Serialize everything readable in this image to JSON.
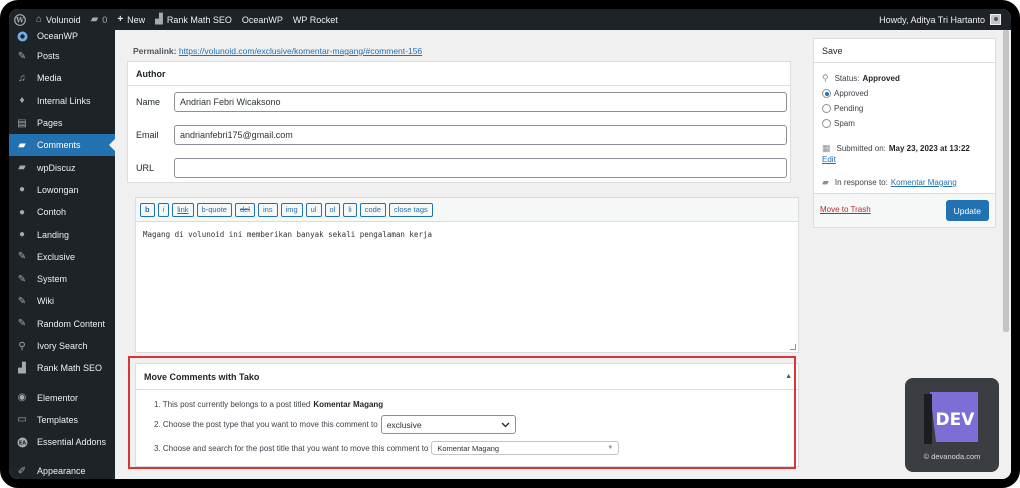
{
  "adminbar": {
    "site_name": "Volunoid",
    "comments_count": "0",
    "new_label": "New",
    "rank_math": "Rank Math SEO",
    "oceanwp": "OceanWP",
    "wp_rocket": "WP Rocket",
    "howdy": "Howdy, Aditya Tri Hartanto"
  },
  "sidebar": {
    "items": [
      {
        "label": "OceanWP",
        "icon": "oceanwp-icon"
      },
      {
        "label": "Posts",
        "icon": "pin-icon"
      },
      {
        "label": "Media",
        "icon": "media-icon"
      },
      {
        "label": "Internal Links",
        "icon": "drop-icon"
      },
      {
        "label": "Pages",
        "icon": "pages-icon"
      },
      {
        "label": "Comments",
        "icon": "comment-icon"
      },
      {
        "label": "wpDiscuz",
        "icon": "comment-icon"
      },
      {
        "label": "Lowongan",
        "icon": "globe-icon"
      },
      {
        "label": "Contoh",
        "icon": "globe-icon"
      },
      {
        "label": "Landing",
        "icon": "globe-icon"
      },
      {
        "label": "Exclusive",
        "icon": "pin-icon"
      },
      {
        "label": "System",
        "icon": "pin-icon"
      },
      {
        "label": "Wiki",
        "icon": "pin-icon"
      },
      {
        "label": "Random Content",
        "icon": "pin-icon"
      },
      {
        "label": "Ivory Search",
        "icon": "search-icon"
      },
      {
        "label": "Rank Math SEO",
        "icon": "rank-math-icon"
      },
      {
        "label": "Elementor",
        "icon": "elementor-icon"
      },
      {
        "label": "Templates",
        "icon": "folder-icon"
      },
      {
        "label": "Essential Addons",
        "icon": "ea-icon"
      },
      {
        "label": "Appearance",
        "icon": "brush-icon"
      }
    ],
    "active": "Comments"
  },
  "permalink": {
    "label": "Permalink:",
    "url": "https://volunoid.com/exclusive/komentar-magang/#comment-156"
  },
  "author": {
    "title": "Author",
    "name_label": "Name",
    "name_value": "Andrian Febri Wicaksono",
    "email_label": "Email",
    "email_value": "andrianfebri175@gmail.com",
    "url_label": "URL",
    "url_value": ""
  },
  "editor": {
    "buttons": [
      "b",
      "i",
      "link",
      "b-quote",
      "del",
      "ins",
      "img",
      "ul",
      "ol",
      "li",
      "code",
      "close tags"
    ],
    "content": "Magang di volunoid ini memberikan banyak sekali pengalaman kerja"
  },
  "tako": {
    "title": "Move Comments with Tako",
    "line1_prefix": "1. This post currently belongs to a post titled",
    "line1_post": "Komentar Magang",
    "line2": "2. Choose the post type that you want to move this comment to",
    "post_type": "exclusive",
    "line3": "3. Choose and search for the post title that you want to move this comment to",
    "post_title": "Komentar Magang"
  },
  "save": {
    "title": "Save",
    "status_label": "Status:",
    "status_value": "Approved",
    "options": [
      "Approved",
      "Pending",
      "Spam"
    ],
    "selected": "Approved",
    "submitted_label": "Submitted on:",
    "submitted_value": "May 23, 2023 at 13:22",
    "edit_label": "Edit",
    "response_label": "In response to:",
    "response_link": "Komentar Magang",
    "trash_label": "Move to Trash",
    "update_label": "Update"
  },
  "watermark": {
    "logo_text": "DEV",
    "caption": "© devanoda.com"
  },
  "colors": {
    "accent": "#2271b1",
    "adminbar": "#1d2327",
    "highlight": "#d63638"
  }
}
